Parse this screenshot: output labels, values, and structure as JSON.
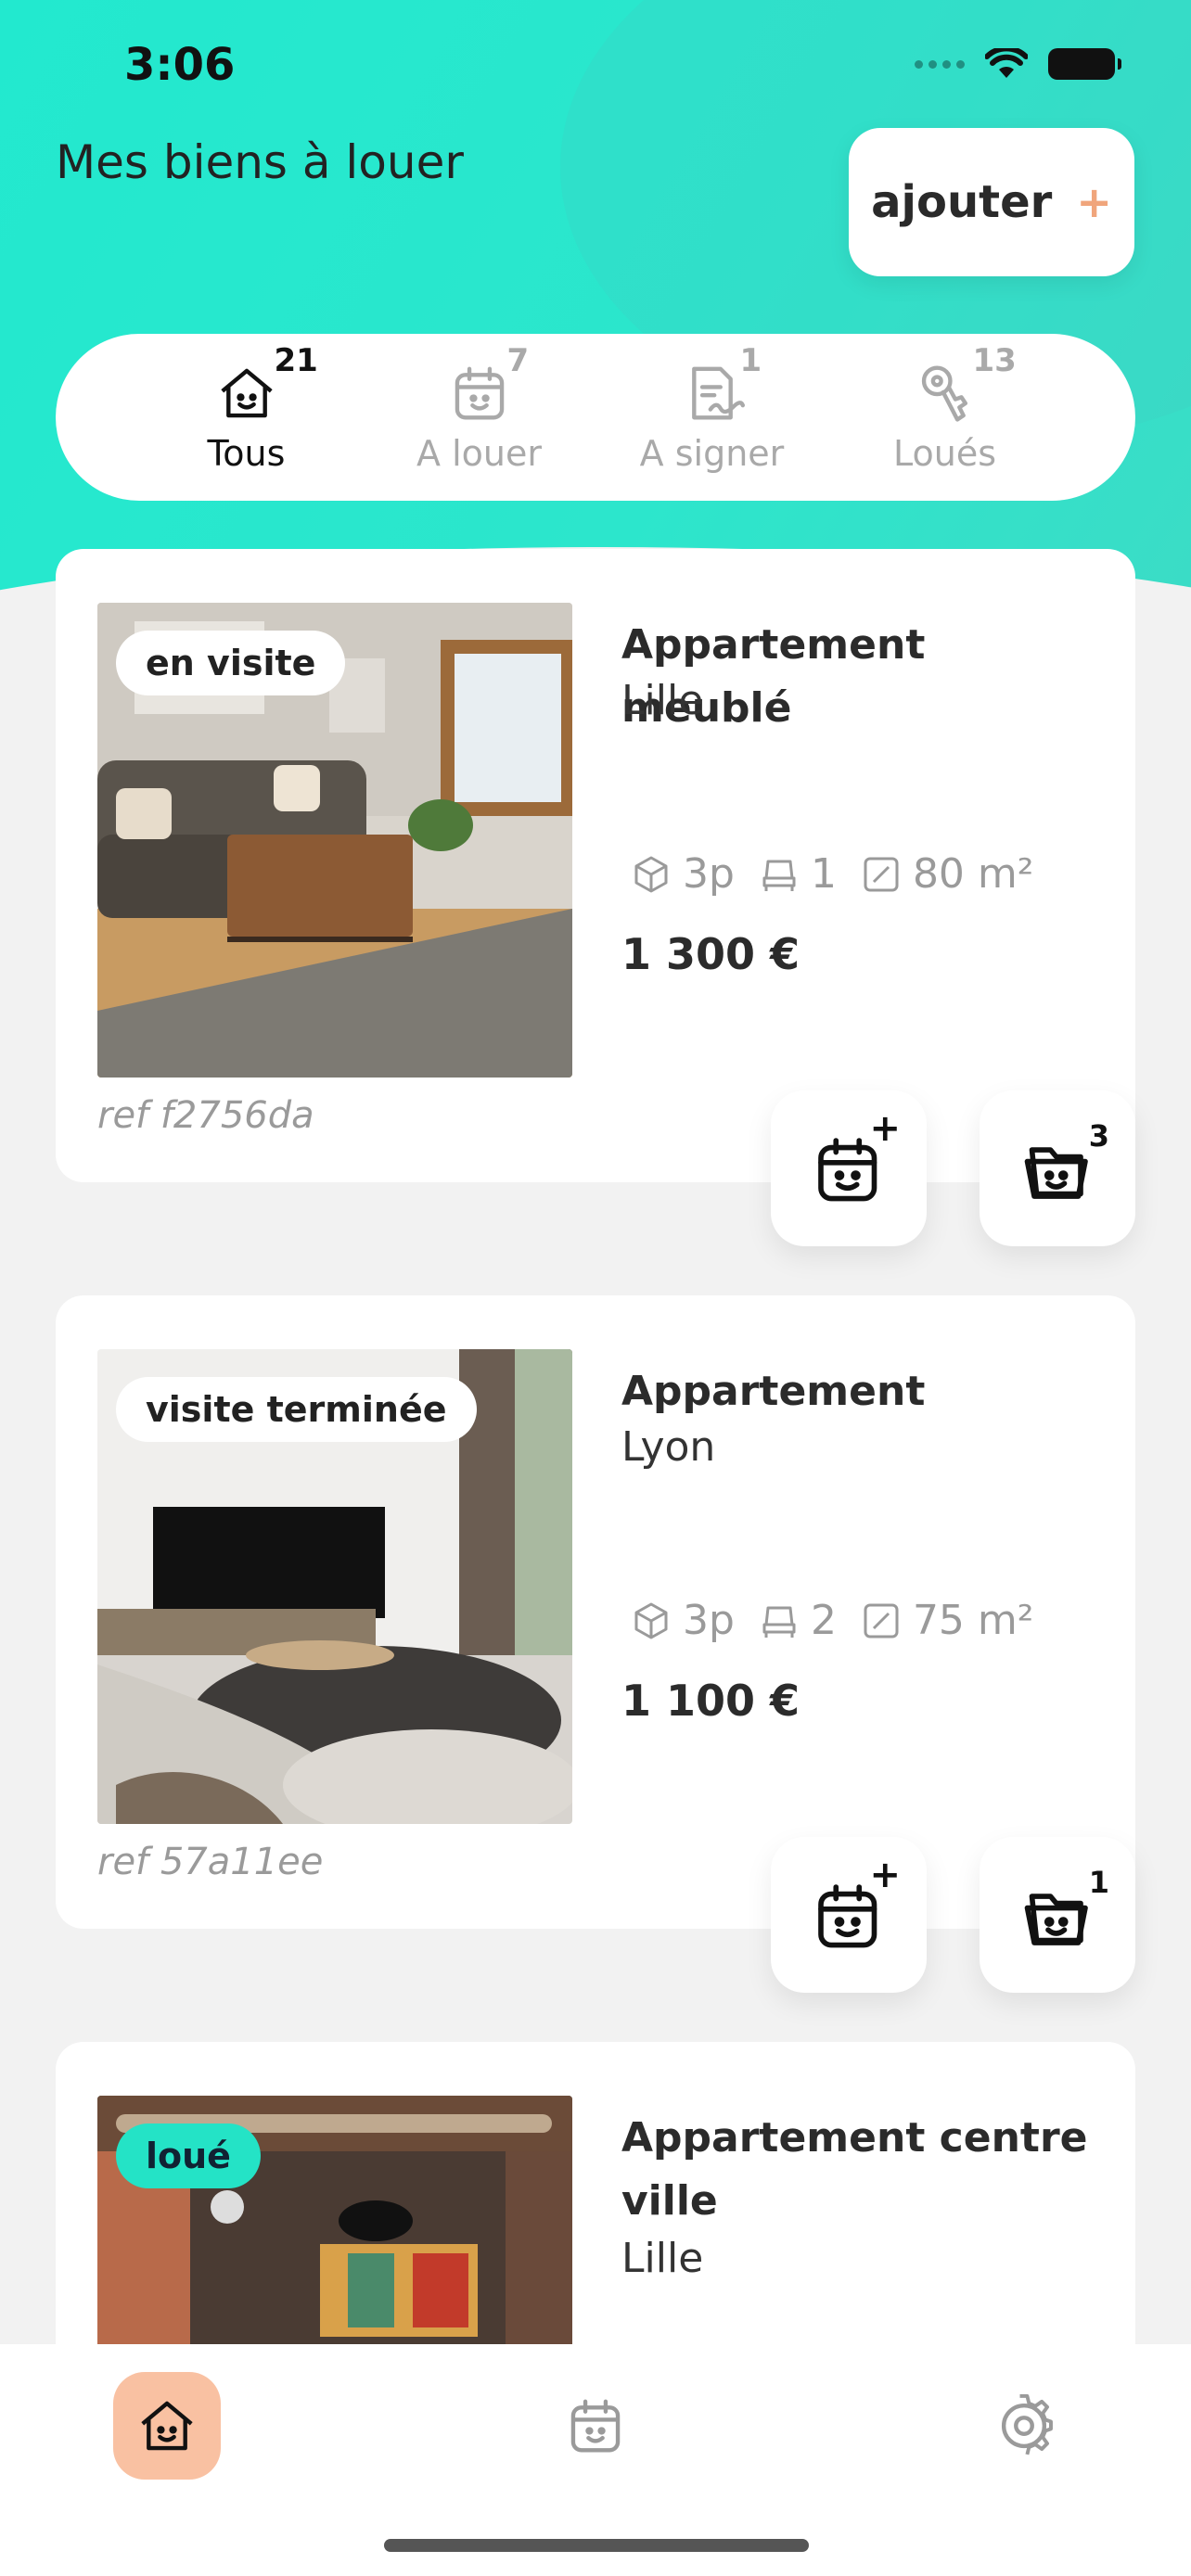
{
  "status": {
    "time": "3:06"
  },
  "header": {
    "title": "Mes biens à louer",
    "add_label": "ajouter",
    "add_icon": "+"
  },
  "tabs": [
    {
      "label": "Tous",
      "count": "21",
      "icon": "house-icon",
      "active": true
    },
    {
      "label": "A louer",
      "count": "7",
      "icon": "calendar-icon"
    },
    {
      "label": "A signer",
      "count": "1",
      "icon": "document-sign-icon"
    },
    {
      "label": "Loués",
      "count": "13",
      "icon": "key-icon"
    }
  ],
  "listings": [
    {
      "status_badge": "en visite",
      "title": "Appartement meublé",
      "city": "Lille",
      "rooms": "3p",
      "beds": "1",
      "area": "80 m²",
      "price": "1 300 €",
      "ref": "ref f2756da",
      "visit_mark": "+",
      "folder_count": "3"
    },
    {
      "status_badge": "visite terminée",
      "title": "Appartement",
      "city": "Lyon",
      "rooms": "3p",
      "beds": "2",
      "area": "75 m²",
      "price": "1 100 €",
      "ref": "ref 57a11ee",
      "visit_mark": "+",
      "folder_count": "1"
    },
    {
      "status_badge": "loué",
      "title": "Appartement centre ville",
      "city": "Lille"
    }
  ],
  "colors": {
    "accent": "#22e9cf",
    "peach": "#f9c1a2",
    "plus": "#f0a57c"
  }
}
